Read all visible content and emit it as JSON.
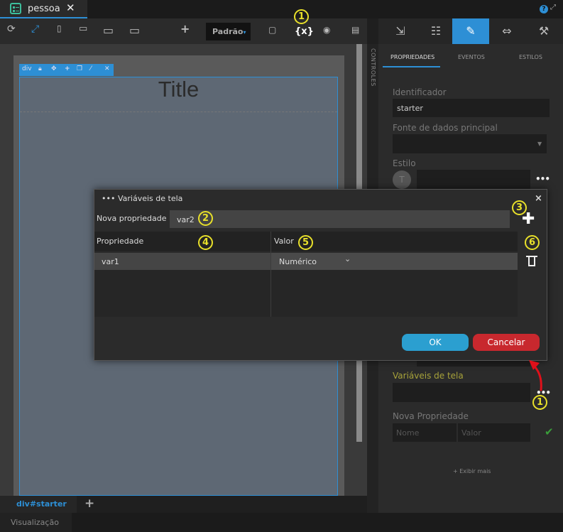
{
  "file_tab": {
    "name": "pessoa",
    "close": "✕"
  },
  "toolbar": {
    "refresh": "⟳",
    "resize": "⤢",
    "device_phone": "▯",
    "device_tablet": "▭",
    "device_desktop": "▭",
    "device_wide": "▭",
    "add": "+",
    "standard_label": "Padrão",
    "standard_caret": "▾",
    "vars_label": "{x}"
  },
  "right_panel": {
    "sub_tabs": {
      "properties": "PROPRIEDADES",
      "events": "EVENTOS",
      "styles": "ESTILOS"
    },
    "identifier_label": "Identificador",
    "identifier_value": "starter",
    "datasource_label": "Fonte de dados principal",
    "style_label": "Estilo",
    "style_avatar": "T",
    "screen_vars_label": "Variáveis de tela",
    "new_prop_label": "Nova Propriedade",
    "name_placeholder": "Nome",
    "value_placeholder": "Valor",
    "show_more": "+ Exibir mais",
    "dots": "•••",
    "check": "✔"
  },
  "controls_label": "CONTROLES",
  "canvas": {
    "div_label": "div",
    "title": "Title"
  },
  "breadcrumb": "div#starter",
  "add_tab": "+",
  "preview_label": "Visualização",
  "dialog": {
    "title": "••• Variáveis de tela",
    "close": "×",
    "new_property_label": "Nova propriedade",
    "new_property_value": "var2",
    "add": "✚",
    "col_property": "Propriedade",
    "col_value": "Valor",
    "rows": [
      {
        "name": "var1",
        "type": "Numérico"
      }
    ],
    "chevron": "⌄",
    "ok_label": "OK",
    "cancel_label": "Cancelar"
  },
  "callouts": [
    "1",
    "2",
    "3",
    "4",
    "5",
    "6",
    "1"
  ],
  "colors": {
    "accent": "#2d8fd5",
    "ok": "#2b9fd0",
    "cancel": "#c8282e",
    "callout": "#e8e02a",
    "arrow": "#e0101a"
  }
}
